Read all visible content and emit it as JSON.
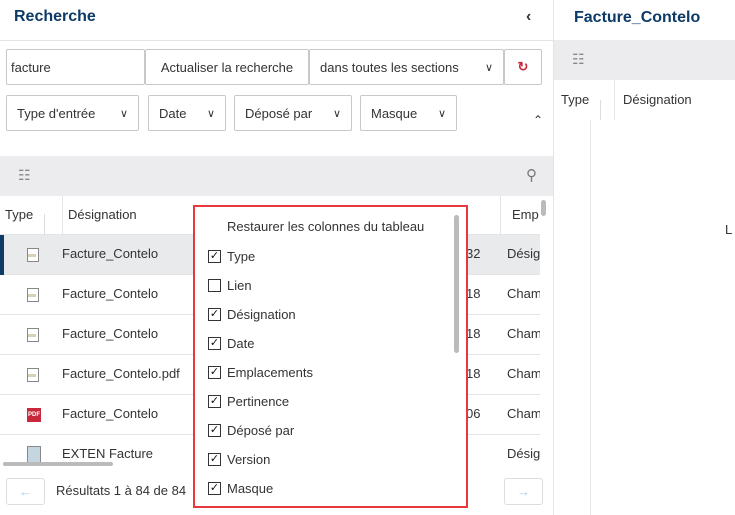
{
  "left": {
    "title": "Recherche",
    "collapse_icon": "chevron-left-icon",
    "search": {
      "value": "facture",
      "refresh_label": "Actualiser la recherche",
      "scope": "dans toutes les sections",
      "reset_icon": "reset-icon"
    },
    "filters": [
      "Type d'entrée",
      "Date",
      "Déposé par",
      "Masque"
    ],
    "columns": [
      "Type",
      "Désignation",
      "Emp"
    ],
    "rows": [
      {
        "icon": "document-icon",
        "name": "Facture_Contelo",
        "date": "32",
        "emp": "Désig",
        "selected": true
      },
      {
        "icon": "document-icon",
        "name": "Facture_Contelo",
        "date": "18",
        "emp": "Cham"
      },
      {
        "icon": "document-icon",
        "name": "Facture_Contelo",
        "date": "18",
        "emp": "Cham"
      },
      {
        "icon": "document-icon",
        "name": "Facture_Contelo.pdf",
        "date": "18",
        "emp": "Cham"
      },
      {
        "icon": "pdf-icon",
        "name": "Facture_Contelo",
        "date": "06",
        "emp": "Cham"
      },
      {
        "icon": "folder-icon",
        "name": "EXTEN Facture",
        "date": "",
        "emp": "Désig"
      }
    ],
    "results": "Résultats 1 à 84 de 84"
  },
  "popup": {
    "title": "Restaurer les colonnes du tableau",
    "options": [
      {
        "label": "Type",
        "checked": true
      },
      {
        "label": "Lien",
        "checked": false
      },
      {
        "label": "Désignation",
        "checked": true
      },
      {
        "label": "Date",
        "checked": true
      },
      {
        "label": "Emplacements",
        "checked": true
      },
      {
        "label": "Pertinence",
        "checked": true
      },
      {
        "label": "Déposé par",
        "checked": true
      },
      {
        "label": "Version",
        "checked": true
      },
      {
        "label": "Masque",
        "checked": true
      }
    ]
  },
  "right": {
    "title": "Facture_Contelo",
    "columns": [
      "Type",
      "Désignation"
    ],
    "partial_text": "L"
  },
  "colors": {
    "accent": "#0d3a66",
    "highlight": "#e8383d"
  }
}
